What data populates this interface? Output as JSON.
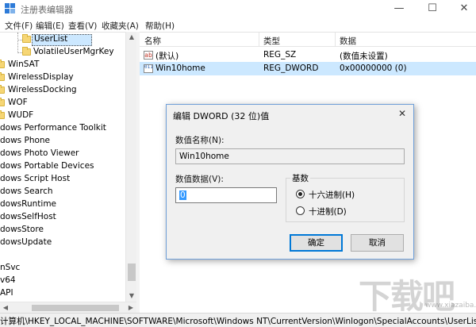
{
  "window": {
    "title": "注册表编辑器",
    "min": "—",
    "max": "☐",
    "close": "✕"
  },
  "menu": [
    "文件(F)",
    "编辑(E)",
    "查看(V)",
    "收藏夹(A)",
    "帮助(H)"
  ],
  "tree": {
    "items": [
      {
        "label": "UserList",
        "selected": true
      },
      {
        "label": "VolatileUserMgrKey"
      },
      {
        "label": "WinSAT"
      },
      {
        "label": "WirelessDisplay"
      },
      {
        "label": "WirelessDocking"
      },
      {
        "label": "WOF"
      },
      {
        "label": "WUDF"
      },
      {
        "label": "dows Performance Toolkit"
      },
      {
        "label": "dows Phone"
      },
      {
        "label": "dows Photo Viewer"
      },
      {
        "label": "dows Portable Devices"
      },
      {
        "label": "dows Script Host"
      },
      {
        "label": "dows Search"
      },
      {
        "label": "dowsRuntime"
      },
      {
        "label": "dowsSelfHost"
      },
      {
        "label": "dowsStore"
      },
      {
        "label": "dowsUpdate"
      },
      {
        "label": "nSvc"
      },
      {
        "label": "v64"
      },
      {
        "label": "API"
      }
    ]
  },
  "list": {
    "columns": [
      "名称",
      "类型",
      "数据"
    ],
    "rows": [
      {
        "icon": "ab",
        "name": "(默认)",
        "type": "REG_SZ",
        "data": "(数值未设置)"
      },
      {
        "icon": "011",
        "name": "Win10home",
        "type": "REG_DWORD",
        "data": "0x00000000 (0)",
        "selected": true
      }
    ]
  },
  "statusbar": {
    "path": "计算机\\HKEY_LOCAL_MACHINE\\SOFTWARE\\Microsoft\\Windows NT\\CurrentVersion\\Winlogon\\SpecialAccounts\\UserList"
  },
  "dialog": {
    "title": "编辑 DWORD (32 位)值",
    "close": "✕",
    "name_label": "数值名称(N):",
    "name_value": "Win10home",
    "data_label": "数值数据(V):",
    "data_value": "0",
    "base_label": "基数",
    "hex_label": "十六进制(H)",
    "dec_label": "十进制(D)",
    "base_selected": "hex",
    "ok": "确定",
    "cancel": "取消"
  },
  "watermark": {
    "text": "下载吧",
    "sub": "www.xiazaiba.com"
  },
  "colors": {
    "selection": "#cce8ff",
    "accent": "#0078d7",
    "dialog_border": "#6f9fd8"
  }
}
